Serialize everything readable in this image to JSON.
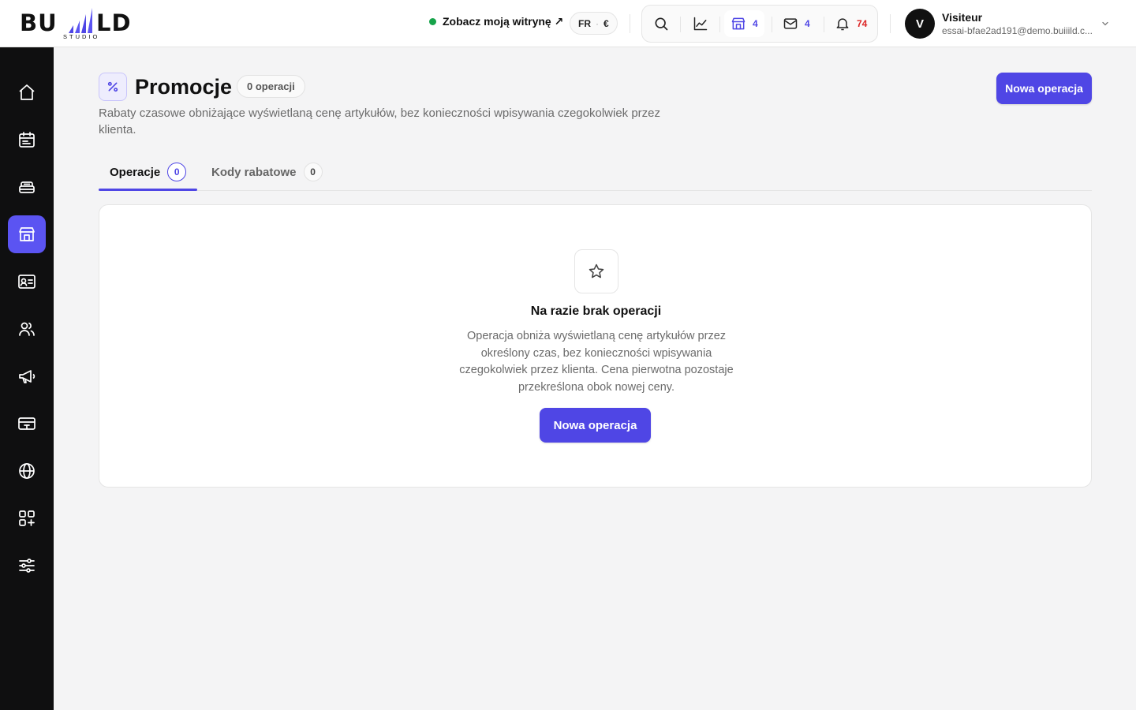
{
  "brand": {
    "logo_text_left": "BU",
    "logo_text_right": "LD",
    "logo_subtext": "STUDIO",
    "accent": "#4f46e5"
  },
  "header": {
    "site_link": "Zobacz moją witrynę ↗",
    "lang": "FR",
    "currency": "€",
    "tools": [
      {
        "icon": "search-icon"
      },
      {
        "icon": "analytics-icon"
      },
      {
        "icon": "store-icon",
        "count": "4"
      },
      {
        "icon": "mail-icon",
        "count": "4"
      },
      {
        "icon": "bell-icon",
        "count": "74"
      }
    ],
    "user": {
      "initial": "V",
      "name": "Visiteur",
      "email": "essai-bfae2ad191@demo.buiiild.c..."
    }
  },
  "sidebar": {
    "items": [
      {
        "icon": "home-icon"
      },
      {
        "icon": "calendar-icon"
      },
      {
        "icon": "box-icon"
      },
      {
        "icon": "store-icon",
        "active": true
      },
      {
        "icon": "contact-card-icon"
      },
      {
        "icon": "users-icon"
      },
      {
        "icon": "megaphone-icon"
      },
      {
        "icon": "payment-icon"
      },
      {
        "icon": "globe-icon"
      },
      {
        "icon": "apps-icon"
      },
      {
        "icon": "settings-sliders-icon"
      }
    ]
  },
  "page": {
    "title": "Promocje",
    "count_label": "0 operacji",
    "subtitle": "Rabaty czasowe obniżające wyświetlaną cenę artykułów, bez konieczności wpisywania czegokolwiek przez klienta.",
    "new_button": "Nowa operacja",
    "tabs": [
      {
        "label": "Operacje",
        "count": "0",
        "active": true
      },
      {
        "label": "Kody rabatowe",
        "count": "0",
        "active": false
      }
    ],
    "empty_state": {
      "title": "Na razie brak operacji",
      "description": "Operacja obniża wyświetlaną cenę artykułów przez określony czas, bez konieczności wpisywania czegokolwiek przez klienta. Cena pierwotna pozostaje przekreślona obok nowej ceny.",
      "button": "Nowa operacja"
    }
  }
}
